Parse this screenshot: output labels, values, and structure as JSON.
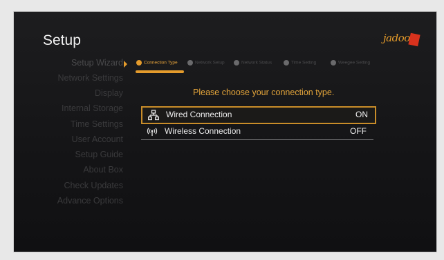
{
  "header": {
    "title": "Setup",
    "brand": "jadoo"
  },
  "sidebar": {
    "items": [
      {
        "label": "Setup Wizard"
      },
      {
        "label": "Network Settings"
      },
      {
        "label": "Display"
      },
      {
        "label": "Internal Storage"
      },
      {
        "label": "Time Settings"
      },
      {
        "label": "User Account"
      },
      {
        "label": "Setup Guide"
      },
      {
        "label": "About Box"
      },
      {
        "label": "Check Updates"
      },
      {
        "label": "Advance Options"
      }
    ]
  },
  "wizard": {
    "steps": [
      {
        "label": "Connection Type"
      },
      {
        "label": "Network Setup"
      },
      {
        "label": "Network Status"
      },
      {
        "label": "Time Setting"
      },
      {
        "label": "Weegee Setting"
      }
    ],
    "prompt": "Please choose your connection type.",
    "options": [
      {
        "label": "Wired Connection",
        "value": "ON",
        "icon": "network-icon"
      },
      {
        "label": "Wireless Connection",
        "value": "OFF",
        "icon": "wireless-icon"
      }
    ]
  },
  "colors": {
    "accent": "#e49b2c",
    "background": "#151517"
  }
}
